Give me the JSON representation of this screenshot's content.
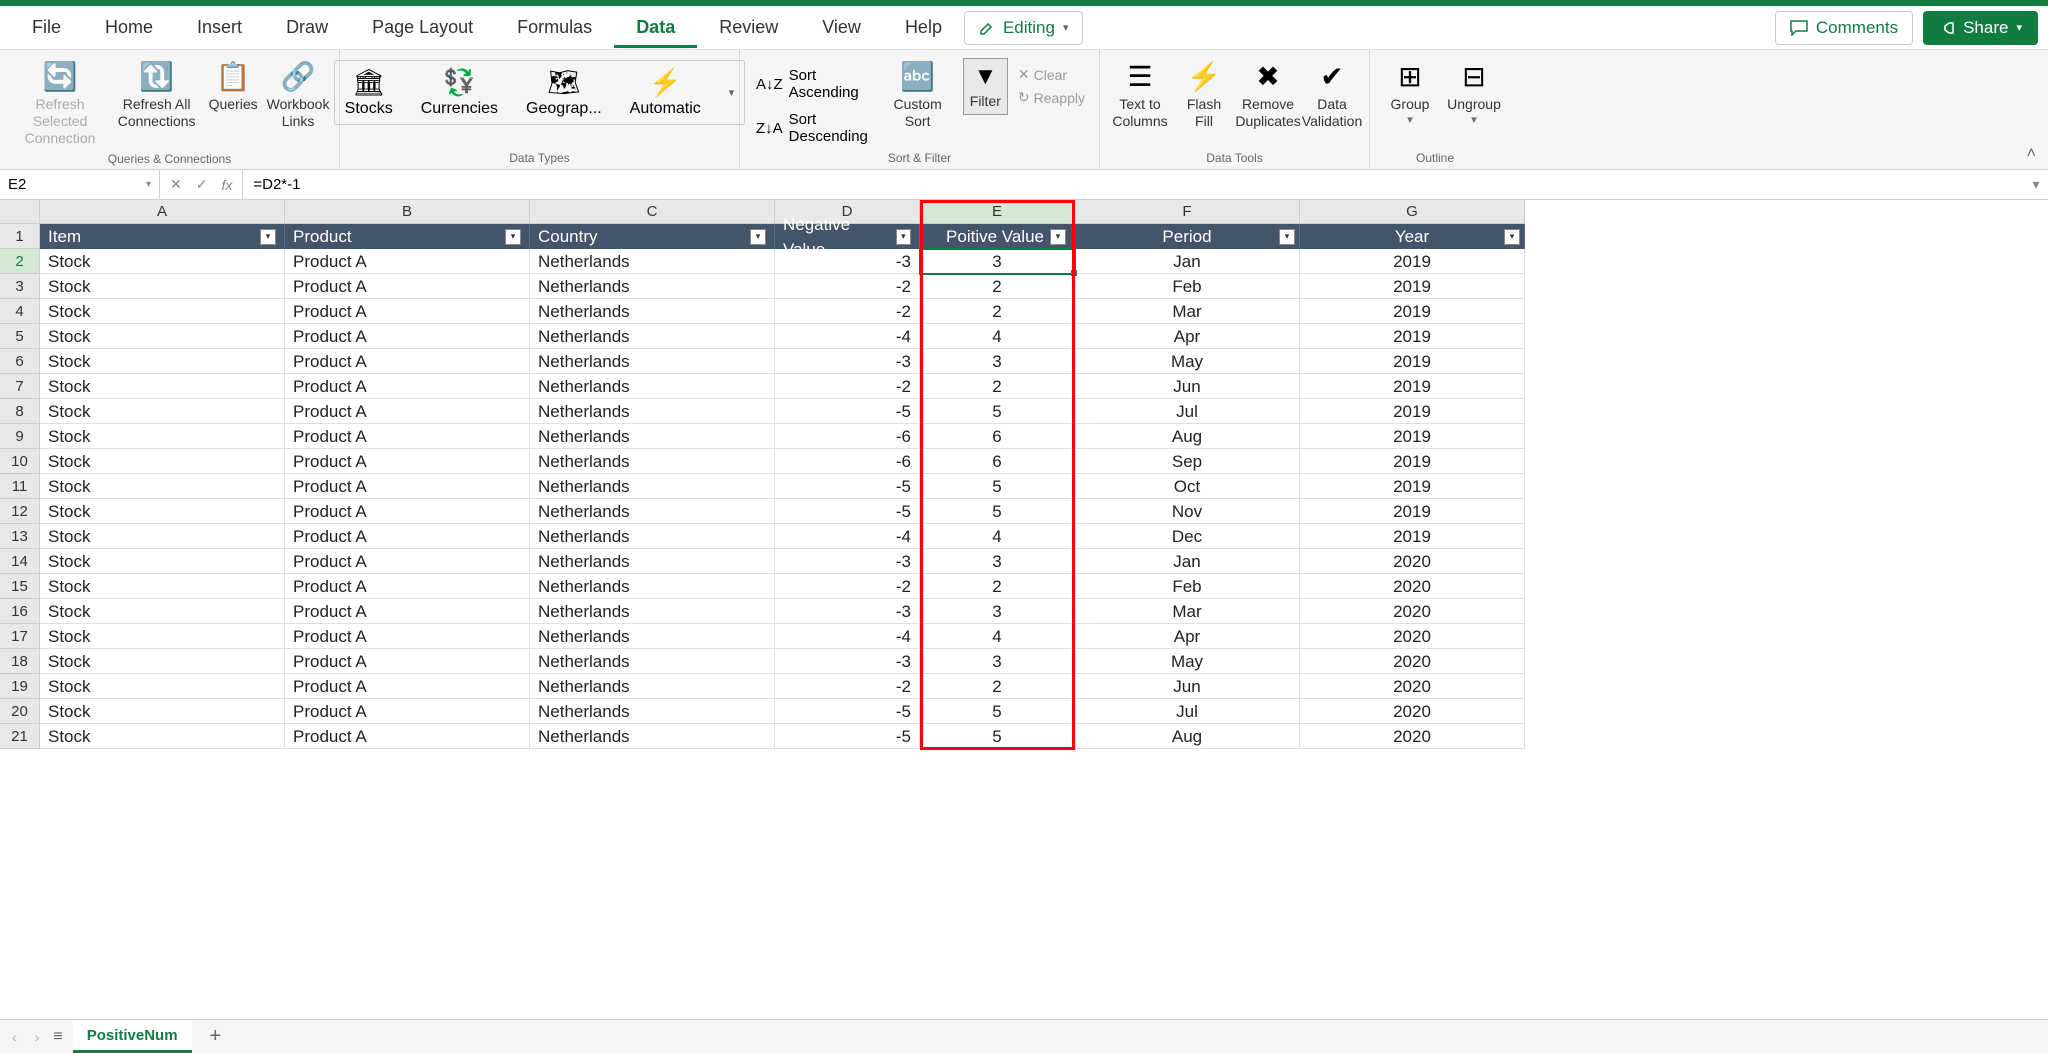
{
  "menu": {
    "file": "File",
    "home": "Home",
    "insert": "Insert",
    "draw": "Draw",
    "page_layout": "Page Layout",
    "formulas": "Formulas",
    "data": "Data",
    "review": "Review",
    "view": "View",
    "help": "Help"
  },
  "topright": {
    "editing": "Editing",
    "comments": "Comments",
    "share": "Share"
  },
  "ribbon": {
    "queries": {
      "refresh_selected": "Refresh Selected Connection",
      "refresh_all": "Refresh All Connections",
      "queries": "Queries",
      "workbook_links": "Workbook Links",
      "group": "Queries & Connections"
    },
    "data_types": {
      "stocks": "Stocks",
      "currencies": "Currencies",
      "geography": "Geograp...",
      "automatic": "Automatic",
      "group": "Data Types"
    },
    "sort_filter": {
      "asc": "Sort Ascending",
      "desc": "Sort Descending",
      "custom": "Custom Sort",
      "filter": "Filter",
      "clear": "Clear",
      "reapply": "Reapply",
      "group": "Sort & Filter"
    },
    "data_tools": {
      "text_to_columns": "Text to Columns",
      "flash_fill": "Flash Fill",
      "remove_duplicates": "Remove Duplicates",
      "data_validation": "Data Validation",
      "group": "Data Tools"
    },
    "outline": {
      "group": "Group",
      "ungroup": "Ungroup",
      "label": "Outline"
    }
  },
  "formula_bar": {
    "name_box": "E2",
    "formula": "=D2*-1"
  },
  "columns": [
    "A",
    "B",
    "C",
    "D",
    "E",
    "F",
    "G"
  ],
  "headers": {
    "item": "Item",
    "product": "Product",
    "country": "Country",
    "neg": "Negative Value",
    "pos": "Poitive Value",
    "period": "Period",
    "year": "Year"
  },
  "rows": [
    {
      "n": 1
    },
    {
      "n": 2,
      "item": "Stock",
      "product": "Product A",
      "country": "Netherlands",
      "neg": "-3",
      "pos": "3",
      "period": "Jan",
      "year": "2019"
    },
    {
      "n": 3,
      "item": "Stock",
      "product": "Product A",
      "country": "Netherlands",
      "neg": "-2",
      "pos": "2",
      "period": "Feb",
      "year": "2019"
    },
    {
      "n": 4,
      "item": "Stock",
      "product": "Product A",
      "country": "Netherlands",
      "neg": "-2",
      "pos": "2",
      "period": "Mar",
      "year": "2019"
    },
    {
      "n": 5,
      "item": "Stock",
      "product": "Product A",
      "country": "Netherlands",
      "neg": "-4",
      "pos": "4",
      "period": "Apr",
      "year": "2019"
    },
    {
      "n": 6,
      "item": "Stock",
      "product": "Product A",
      "country": "Netherlands",
      "neg": "-3",
      "pos": "3",
      "period": "May",
      "year": "2019"
    },
    {
      "n": 7,
      "item": "Stock",
      "product": "Product A",
      "country": "Netherlands",
      "neg": "-2",
      "pos": "2",
      "period": "Jun",
      "year": "2019"
    },
    {
      "n": 8,
      "item": "Stock",
      "product": "Product A",
      "country": "Netherlands",
      "neg": "-5",
      "pos": "5",
      "period": "Jul",
      "year": "2019"
    },
    {
      "n": 9,
      "item": "Stock",
      "product": "Product A",
      "country": "Netherlands",
      "neg": "-6",
      "pos": "6",
      "period": "Aug",
      "year": "2019"
    },
    {
      "n": 10,
      "item": "Stock",
      "product": "Product A",
      "country": "Netherlands",
      "neg": "-6",
      "pos": "6",
      "period": "Sep",
      "year": "2019"
    },
    {
      "n": 11,
      "item": "Stock",
      "product": "Product A",
      "country": "Netherlands",
      "neg": "-5",
      "pos": "5",
      "period": "Oct",
      "year": "2019"
    },
    {
      "n": 12,
      "item": "Stock",
      "product": "Product A",
      "country": "Netherlands",
      "neg": "-5",
      "pos": "5",
      "period": "Nov",
      "year": "2019"
    },
    {
      "n": 13,
      "item": "Stock",
      "product": "Product A",
      "country": "Netherlands",
      "neg": "-4",
      "pos": "4",
      "period": "Dec",
      "year": "2019"
    },
    {
      "n": 14,
      "item": "Stock",
      "product": "Product A",
      "country": "Netherlands",
      "neg": "-3",
      "pos": "3",
      "period": "Jan",
      "year": "2020"
    },
    {
      "n": 15,
      "item": "Stock",
      "product": "Product A",
      "country": "Netherlands",
      "neg": "-2",
      "pos": "2",
      "period": "Feb",
      "year": "2020"
    },
    {
      "n": 16,
      "item": "Stock",
      "product": "Product A",
      "country": "Netherlands",
      "neg": "-3",
      "pos": "3",
      "period": "Mar",
      "year": "2020"
    },
    {
      "n": 17,
      "item": "Stock",
      "product": "Product A",
      "country": "Netherlands",
      "neg": "-4",
      "pos": "4",
      "period": "Apr",
      "year": "2020"
    },
    {
      "n": 18,
      "item": "Stock",
      "product": "Product A",
      "country": "Netherlands",
      "neg": "-3",
      "pos": "3",
      "period": "May",
      "year": "2020"
    },
    {
      "n": 19,
      "item": "Stock",
      "product": "Product A",
      "country": "Netherlands",
      "neg": "-2",
      "pos": "2",
      "period": "Jun",
      "year": "2020"
    },
    {
      "n": 20,
      "item": "Stock",
      "product": "Product A",
      "country": "Netherlands",
      "neg": "-5",
      "pos": "5",
      "period": "Jul",
      "year": "2020"
    },
    {
      "n": 21,
      "item": "Stock",
      "product": "Product A",
      "country": "Netherlands",
      "neg": "-5",
      "pos": "5",
      "period": "Aug",
      "year": "2020"
    }
  ],
  "sheet": {
    "name": "PositiveNum"
  },
  "active_cell": "E2",
  "highlighted_column": "E"
}
